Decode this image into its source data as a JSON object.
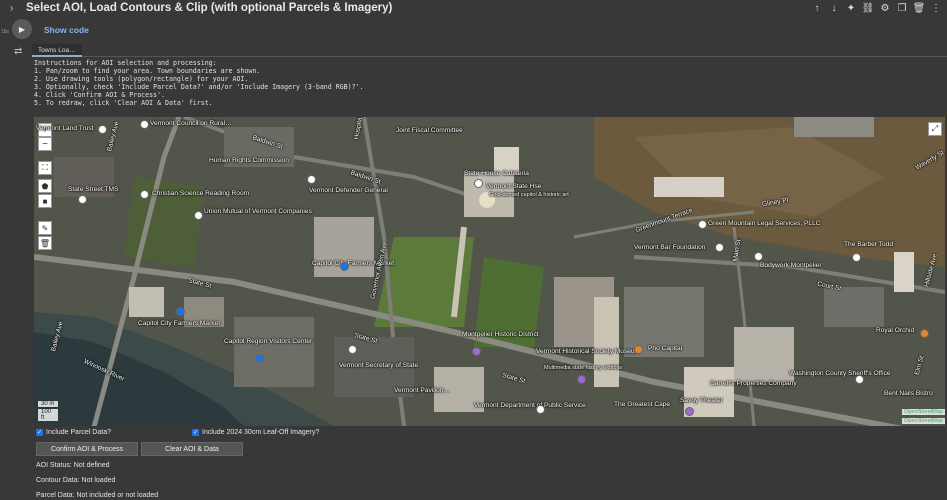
{
  "header": {
    "title": "Select AOI, Load Contours & Clip (with optional Parcels & Imagery)",
    "icons": [
      "arrow-up-icon",
      "arrow-down-icon",
      "sparkle-icon",
      "link-icon",
      "gear-icon",
      "mirror-icon",
      "trash-icon",
      "more-icon"
    ]
  },
  "cell": {
    "run_timestamp": "18s",
    "show_code": "Show code",
    "output_tab": "Towns Loa…"
  },
  "instructions": [
    "Instructions for AOI selection and processing:",
    "1. Pan/zoom to find your area. Town boundaries are shown.",
    "2. Use drawing tools (polygon/rectangle) for your AOI.",
    "3. Optionally, check 'Include Parcel Data?' and/or 'Include Imagery (3-band RGB)?'.",
    "4. Click 'Confirm AOI & Process'.",
    "5. To redraw, click 'Clear AOI & Data' first."
  ],
  "map": {
    "labels": {
      "vermont_land_trust": "Vermont Land Trust",
      "council_rural": "Vermont Council on Rural…",
      "joint_fiscal": "Joint Fiscal Committee",
      "baldwin_st_1": "Baldwin St",
      "baldwin_st_2": "Baldwin St",
      "human_rights": "Human Rights Commission",
      "state_house_cafe": "State House Cafeteria",
      "vt_state_house": "Vermont State Hse",
      "vt_state_house_sub": "Gold-domed capitol & historic art",
      "vt_defender": "Vermont Defender General",
      "state_st_tms": "State Street TMS",
      "christian_science": "Christian Science Reading Room",
      "union_mutual": "Union Mutual of Vermont Companies",
      "capitol_city_market_1": "Capitol City Farmers Market",
      "greenmount_terrace": "Greenmount Terrace",
      "green_mountain_legal": "Green Mountain Legal Services, PLLC",
      "vt_bar_foundation": "Vermont Bar Foundation",
      "gliney_pl": "Gliney Pl",
      "waverly": "Waverly St",
      "barber_todd": "The Barber Todd",
      "bodywork": "Bodywork Montpelier",
      "state_st_1": "State St",
      "state_st_2": "State St",
      "state_st_3": "State St",
      "court_st": "Court St",
      "capitol_city_market_2": "Capitol City Farmers Market",
      "capitol_region": "Capitol Region Visitors Center",
      "montpelier_hd": "Montpelier Historic District",
      "vt_historical": "Vermont Historical Society Museum",
      "vt_historical_sub": "Multimedia state history exhibits",
      "pho_capital": "Pho Capital",
      "royal_orchid": "Royal Orchid",
      "washington_sheriff": "Washington County Sheriff's Office",
      "bent_nails": "Bent Nails Bistro",
      "secretary_state": "Vermont Secretary of State",
      "vt_public_service": "Vermont Department of Public Service",
      "greatest_cape": "The Greatest Cape",
      "savoy": "Savoy Theater",
      "carretts": "Carrett's Properties Company",
      "vt_pavilion": "Vermont Pavilion…",
      "winooski": "Winooski River",
      "bailey_ave_1": "Bailey Ave",
      "bailey_ave_2": "Bailey Ave",
      "governor_aiken": "Governor Aiken Ave",
      "elm_st": "Elm St",
      "hillside": "Hillside Ave",
      "main_st": "Main St",
      "hospital": "Hospital…"
    },
    "scale_m": "30 m",
    "scale_ft": "100 ft",
    "attribution": "OpenStreetMap"
  },
  "controls": {
    "include_parcels": "Include Parcel Data?",
    "include_imagery": "Include 2024 30cm Leaf-Off Imagery?",
    "confirm_button": "Confirm AOI & Process",
    "clear_button": "Clear AOI & Data",
    "aoi_status": "AOI Status: Not defined",
    "contour_data": "Contour Data: Not loaded",
    "parcel_data": "Parcel Data: Not included or not loaded"
  }
}
